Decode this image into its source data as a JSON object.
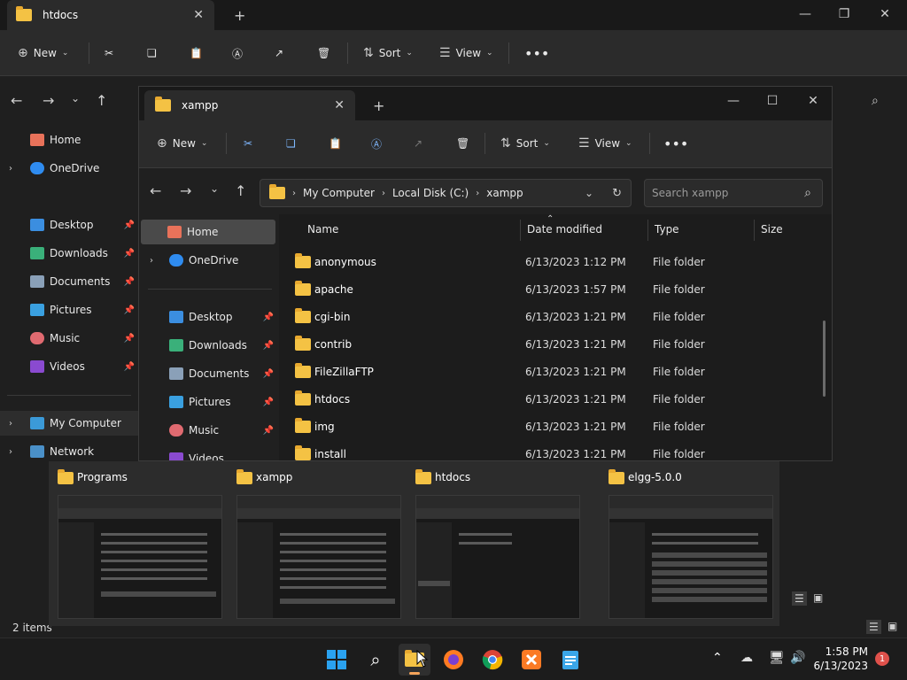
{
  "back_window": {
    "tab_title": "htdocs",
    "toolbar": {
      "new_label": "New",
      "sort_label": "Sort",
      "view_label": "View"
    },
    "sidebar": [
      {
        "label": "Home",
        "icon": "home-icon"
      },
      {
        "label": "OneDrive",
        "icon": "cloud-icon"
      },
      {
        "label": "Desktop",
        "icon": "desktop-icon"
      },
      {
        "label": "Downloads",
        "icon": "download-icon"
      },
      {
        "label": "Documents",
        "icon": "documents-icon"
      },
      {
        "label": "Pictures",
        "icon": "pictures-icon"
      },
      {
        "label": "Music",
        "icon": "music-icon"
      },
      {
        "label": "Videos",
        "icon": "videos-icon"
      },
      {
        "label": "My Computer",
        "icon": "computer-icon"
      },
      {
        "label": "Network",
        "icon": "network-icon"
      }
    ],
    "status": "2 items"
  },
  "front_window": {
    "tab_title": "xampp",
    "toolbar": {
      "new_label": "New",
      "sort_label": "Sort",
      "view_label": "View"
    },
    "breadcrumb": [
      "My Computer",
      "Local Disk (C:)",
      "xampp"
    ],
    "search_placeholder": "Search xampp",
    "sidebar": [
      {
        "label": "Home",
        "icon": "home-icon"
      },
      {
        "label": "OneDrive",
        "icon": "cloud-icon"
      },
      {
        "label": "Desktop",
        "icon": "desktop-icon"
      },
      {
        "label": "Downloads",
        "icon": "download-icon"
      },
      {
        "label": "Documents",
        "icon": "documents-icon"
      },
      {
        "label": "Pictures",
        "icon": "pictures-icon"
      },
      {
        "label": "Music",
        "icon": "music-icon"
      },
      {
        "label": "Videos",
        "icon": "videos-icon"
      }
    ],
    "columns": [
      "Name",
      "Date modified",
      "Type",
      "Size"
    ],
    "rows": [
      {
        "name": "anonymous",
        "date": "6/13/2023 1:12 PM",
        "type": "File folder"
      },
      {
        "name": "apache",
        "date": "6/13/2023 1:57 PM",
        "type": "File folder"
      },
      {
        "name": "cgi-bin",
        "date": "6/13/2023 1:21 PM",
        "type": "File folder"
      },
      {
        "name": "contrib",
        "date": "6/13/2023 1:21 PM",
        "type": "File folder"
      },
      {
        "name": "FileZillaFTP",
        "date": "6/13/2023 1:21 PM",
        "type": "File folder"
      },
      {
        "name": "htdocs",
        "date": "6/13/2023 1:21 PM",
        "type": "File folder"
      },
      {
        "name": "img",
        "date": "6/13/2023 1:21 PM",
        "type": "File folder"
      },
      {
        "name": "install",
        "date": "6/13/2023 1:21 PM",
        "type": "File folder"
      }
    ]
  },
  "previews": [
    {
      "title": "Programs"
    },
    {
      "title": "xampp"
    },
    {
      "title": "htdocs"
    },
    {
      "title": "elgg-5.0.0"
    }
  ],
  "taskbar": {
    "apps": [
      "start-icon",
      "search-icon",
      "file-explorer-icon",
      "firefox-icon",
      "chrome-icon",
      "xampp-icon",
      "notepad-icon"
    ],
    "time": "1:58 PM",
    "date": "6/13/2023",
    "notification_count": "1"
  },
  "colors": {
    "folder": "#f4c244",
    "accent": "#0078d4",
    "badge": "#e0514b"
  }
}
